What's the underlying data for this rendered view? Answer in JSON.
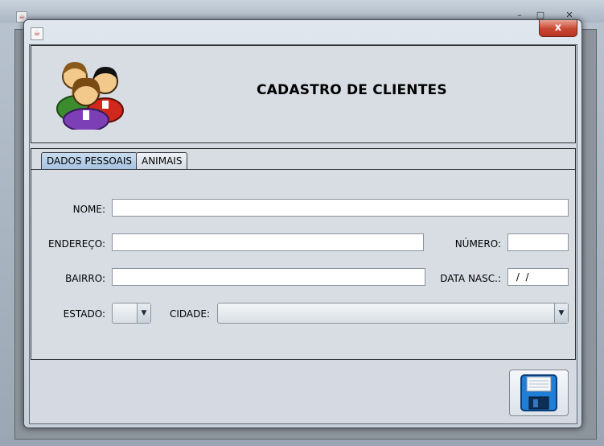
{
  "window": {
    "title": "",
    "controls": [
      "–",
      "□",
      "✕"
    ]
  },
  "dialog": {
    "close_label": "x",
    "java_icon": "java-icon"
  },
  "header": {
    "title": "CADASTRO DE CLIENTES",
    "logo_icon": "users-group-icon"
  },
  "tabs": [
    {
      "label": "DADOS PESSOAIS",
      "active": true
    },
    {
      "label": "ANIMAIS",
      "active": false
    }
  ],
  "form": {
    "nome_label": "NOME:",
    "nome_value": "",
    "endereco_label": "ENDEREÇO:",
    "endereco_value": "",
    "numero_label": "NÚMERO:",
    "numero_value": "",
    "bairro_label": "BAIRRO:",
    "bairro_value": "",
    "data_nasc_label": "DATA NASC.:",
    "data_nasc_value": " /  /",
    "estado_label": "ESTADO:",
    "estado_value": "",
    "cidade_label": "CIDADE:",
    "cidade_value": ""
  },
  "actions": {
    "save_icon": "floppy-disk-icon"
  },
  "colors": {
    "accent": "#a8c4e2",
    "close_red": "#c74632",
    "panel_bg": "#d8dde4"
  }
}
